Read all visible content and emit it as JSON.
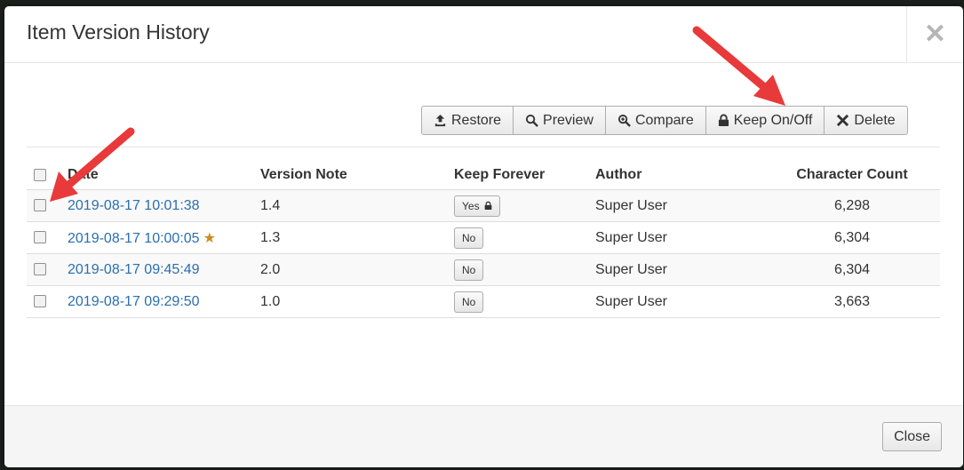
{
  "modal": {
    "title": "Item Version History",
    "close_icon": "close-icon"
  },
  "toolbar": {
    "buttons": [
      {
        "label": "Restore",
        "icon": "upload-icon"
      },
      {
        "label": "Preview",
        "icon": "search-icon"
      },
      {
        "label": "Compare",
        "icon": "zoom-in-icon"
      },
      {
        "label": "Keep On/Off",
        "icon": "lock-icon"
      },
      {
        "label": "Delete",
        "icon": "x-icon"
      }
    ]
  },
  "table": {
    "headers": {
      "date": "Date",
      "version_note": "Version Note",
      "keep_forever": "Keep Forever",
      "author": "Author",
      "character_count": "Character Count"
    },
    "rows": [
      {
        "date": "2019-08-17 10:01:38",
        "starred": false,
        "note": "1.4",
        "keep": "Yes",
        "keep_locked": true,
        "author": "Super User",
        "count": "6,298"
      },
      {
        "date": "2019-08-17 10:00:05",
        "starred": true,
        "note": "1.3",
        "keep": "No",
        "keep_locked": false,
        "author": "Super User",
        "count": "6,304"
      },
      {
        "date": "2019-08-17 09:45:49",
        "starred": false,
        "note": "2.0",
        "keep": "No",
        "keep_locked": false,
        "author": "Super User",
        "count": "6,304"
      },
      {
        "date": "2019-08-17 09:29:50",
        "starred": false,
        "note": "1.0",
        "keep": "No",
        "keep_locked": false,
        "author": "Super User",
        "count": "3,663"
      }
    ]
  },
  "footer": {
    "close_label": "Close"
  },
  "colors": {
    "link": "#2a6fb0",
    "star": "#d0891c",
    "annotation_arrow": "#e8393b"
  }
}
